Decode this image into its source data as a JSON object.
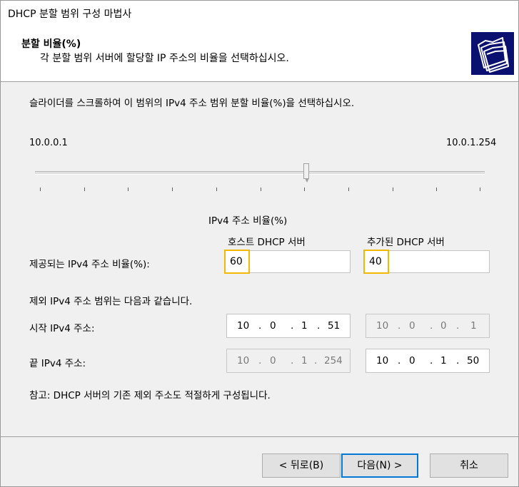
{
  "window": {
    "title": "DHCP 분할 범위 구성 마법사"
  },
  "header": {
    "title": "분할 비율(%)",
    "subtitle": "각 분할 범위 서버에 할당할 IP 주소의 비율을 선택하십시오.",
    "icon": "folders-icon"
  },
  "instruction": "슬라이더를 스크롤하여 이 범위의 IPv4 주소 범위 분할 비율(%)을 선택하십시오.",
  "slider": {
    "start_label": "10.0.0.1",
    "end_label": "10.0.1.254",
    "value_fraction": 0.6
  },
  "ratio": {
    "group_label": "IPv4 주소 비율(%)",
    "host_header": "호스트 DHCP 서버",
    "added_header": "추가된 DHCP 서버",
    "row_label": "제공되는 IPv4 주소 비율(%):",
    "host_value": "60",
    "added_value": "40"
  },
  "exclusion": {
    "label": "제외 IPv4 주소 범위는 다음과 같습니다.",
    "start_label": "시작 IPv4 주소:",
    "end_label": "끝 IPv4 주소:",
    "host_start": [
      "10",
      "0",
      "1",
      "51"
    ],
    "added_start": [
      "10",
      "0",
      "0",
      "1"
    ],
    "host_end": [
      "10",
      "0",
      "1",
      "254"
    ],
    "added_end": [
      "10",
      "0",
      "1",
      "50"
    ]
  },
  "note": "참고: DHCP 서버의 기존 제외 주소도 적절하게 구성됩니다.",
  "buttons": {
    "back": "< 뒤로(B)",
    "next": "다음(N) >",
    "cancel": "취소"
  },
  "colors": {
    "focus_highlight": "#f5b800",
    "default_button_border": "#0078d7",
    "header_icon_bg": "#0a1070"
  }
}
